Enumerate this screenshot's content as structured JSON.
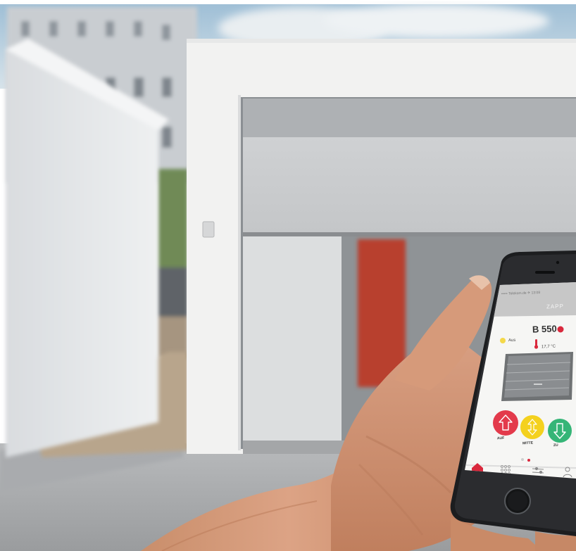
{
  "app": {
    "status_bar": "••••• Telekom.de  ✈  13:08",
    "title": "ZAPP",
    "model": "B 550",
    "light_label": "Aus",
    "temperature": "17,7 °C",
    "buttons": [
      {
        "label": "AUF",
        "icon": "arrow-up-icon",
        "color": "#e33a4b"
      },
      {
        "label": "MITTE",
        "icon": "arrow-middle-icon",
        "color": "#f4d11e"
      },
      {
        "label": "ZU",
        "icon": "arrow-down-icon",
        "color": "#35b577"
      }
    ],
    "tabs": [
      {
        "icon": "home-icon"
      },
      {
        "icon": "grid-icon"
      },
      {
        "icon": "sliders-icon"
      },
      {
        "icon": "user-icon"
      }
    ],
    "page_indicator": {
      "pages": 2,
      "active": 2
    },
    "colors": {
      "header": "#c7c7c7",
      "accent": "#d9283c",
      "screen_bg": "#f6f6f4"
    }
  }
}
